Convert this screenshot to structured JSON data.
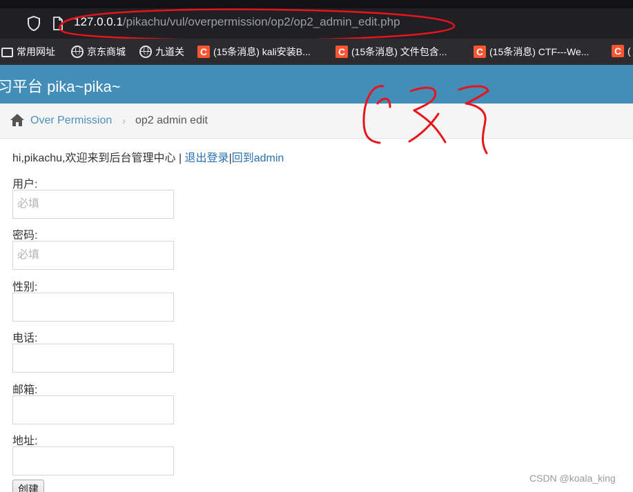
{
  "browser": {
    "url_host": "127.0.0.1",
    "url_path": "/pikachu/vul/overpermission/op2/op2_admin_edit.php",
    "shield_icon": "shield-icon",
    "page_icon": "page-icon"
  },
  "bookmarks": [
    {
      "label": "常用网址",
      "icon": "folder-icon"
    },
    {
      "label": "京东商城",
      "icon": "globe-icon"
    },
    {
      "label": "九道关",
      "icon": "globe-icon"
    },
    {
      "label": "(15条消息) kali安装B...",
      "icon": "csdn-icon"
    },
    {
      "label": "(15条消息) 文件包含...",
      "icon": "csdn-icon"
    },
    {
      "label": "(15条消息) CTF---We...",
      "icon": "csdn-icon"
    },
    {
      "label": "(",
      "icon": "csdn-icon"
    }
  ],
  "header": {
    "brand": "习平台 pika~pika~",
    "color": "#438eb9"
  },
  "breadcrumb": {
    "home_icon": "home-icon",
    "link": "Over Permission",
    "separator": "›",
    "current": "op2 admin edit"
  },
  "welcome": {
    "text": "hi,pikachu,欢迎来到后台管理中心 | ",
    "logout": "退出登录",
    "divider": "|",
    "back": "回到admin"
  },
  "form": {
    "fields": [
      {
        "label": "用户:",
        "placeholder": "必填",
        "value": ""
      },
      {
        "label": "密码:",
        "placeholder": "必填",
        "value": ""
      },
      {
        "label": "性别:",
        "placeholder": "",
        "value": ""
      },
      {
        "label": "电话:",
        "placeholder": "",
        "value": ""
      },
      {
        "label": "邮箱:",
        "placeholder": "",
        "value": ""
      },
      {
        "label": "地址:",
        "placeholder": "",
        "value": ""
      }
    ],
    "submit": "创建"
  },
  "annotation": {
    "color": "#e8141b"
  },
  "watermark": "CSDN @koala_king"
}
